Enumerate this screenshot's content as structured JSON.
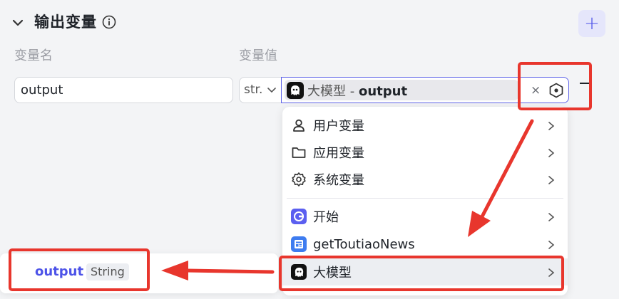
{
  "header": {
    "title": "输出变量",
    "add_symbol": "+"
  },
  "columns": {
    "name_label": "变量名",
    "value_label": "变量值"
  },
  "row": {
    "name_value": "output",
    "type_value": "str.",
    "ref_node": "大模型",
    "ref_separator": " - ",
    "ref_var": "output",
    "clear_symbol": "×"
  },
  "dropdown": {
    "items": [
      {
        "label": "用户变量",
        "icon": "user-icon"
      },
      {
        "label": "应用变量",
        "icon": "folder-icon"
      },
      {
        "label": "系统变量",
        "icon": "gear-icon"
      },
      {
        "label": "开始",
        "icon": "start-node-icon"
      },
      {
        "label": "getToutiaoNews",
        "icon": "plugin-node-icon"
      },
      {
        "label": "大模型",
        "icon": "llm-node-icon"
      }
    ]
  },
  "subpopup": {
    "var_name": "output",
    "var_type": "String"
  },
  "colors": {
    "accent": "#4d53e8",
    "annotation_red": "#e8362d",
    "start_node": "#5b5ff0",
    "plugin_node": "#3e7cf0"
  }
}
